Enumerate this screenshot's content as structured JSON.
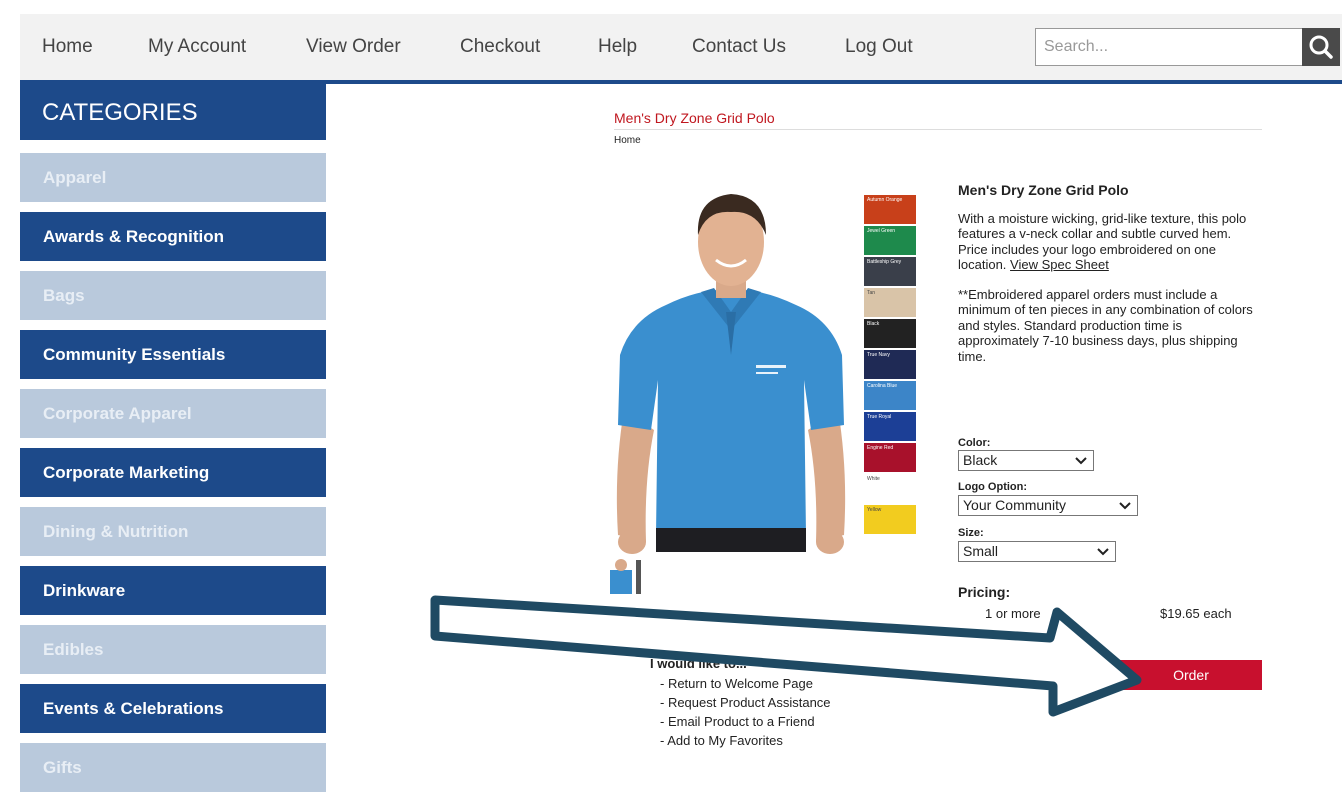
{
  "nav": {
    "items": [
      "Home",
      "My Account",
      "View Order",
      "Checkout",
      "Help",
      "Contact Us",
      "Log Out"
    ],
    "search_placeholder": "Search...",
    "search_icon": "magnifier-icon"
  },
  "sidebar": {
    "header": "CATEGORIES",
    "items": [
      {
        "label": "Apparel"
      },
      {
        "label": "Awards & Recognition"
      },
      {
        "label": "Bags"
      },
      {
        "label": "Community Essentials"
      },
      {
        "label": "Corporate Apparel"
      },
      {
        "label": "Corporate Marketing"
      },
      {
        "label": "Dining & Nutrition"
      },
      {
        "label": "Drinkware"
      },
      {
        "label": "Edibles"
      },
      {
        "label": "Events & Celebrations"
      },
      {
        "label": "Gifts"
      }
    ],
    "colors": {
      "dark": "#1d4a8a",
      "light": "#b9c9dc"
    }
  },
  "product": {
    "title": "Men's Dry Zone Grid Polo",
    "breadcrumb": "Home",
    "name": "Men's Dry Zone Grid Polo",
    "description": "With a moisture wicking, grid-like texture, this polo features a v-neck collar and subtle curved hem. Price includes your logo embroidered on one location.",
    "spec_link": "View Spec Sheet",
    "note": "**Embroidered apparel orders must include a minimum of ten pieces in any combination of colors and styles. Standard production time is approximately 7-10 business days, plus shipping time.",
    "swatches": [
      {
        "label": "Autumn Orange",
        "color": "#c8401a"
      },
      {
        "label": "Jewel Green",
        "color": "#1e8a4c"
      },
      {
        "label": "Battleship Grey",
        "color": "#3a3f4a"
      },
      {
        "label": "Tan",
        "color": "#d9c4a8"
      },
      {
        "label": "Black",
        "color": "#222222"
      },
      {
        "label": "True Navy",
        "color": "#1f2a55"
      },
      {
        "label": "Carolina Blue",
        "color": "#3c85c8"
      },
      {
        "label": "True Royal",
        "color": "#1c3f96"
      },
      {
        "label": "Engine Red",
        "color": "#a8112b"
      },
      {
        "label": "White",
        "color": "#ffffff"
      },
      {
        "label": "Yellow",
        "color": "#f2cc1f"
      }
    ],
    "color_label": "Color:",
    "color_value": "Black",
    "logo_label": "Logo Option:",
    "logo_value": "Your Community",
    "size_label": "Size:",
    "size_value": "Small",
    "pricing_label": "Pricing:",
    "pricing_qty": "1 or more",
    "pricing_price": "$19.65 each",
    "order_label": "Order",
    "more_heading": "I would like to...",
    "more_links": [
      "- Return to Welcome Page",
      "- Request Product Assistance",
      "- Email Product to a Friend",
      "- Add to My Favorites"
    ],
    "shirt_color": "#3a8fcf",
    "order_color": "#c8102e"
  },
  "annotation": {
    "arrow_color": "#1f4a63"
  }
}
